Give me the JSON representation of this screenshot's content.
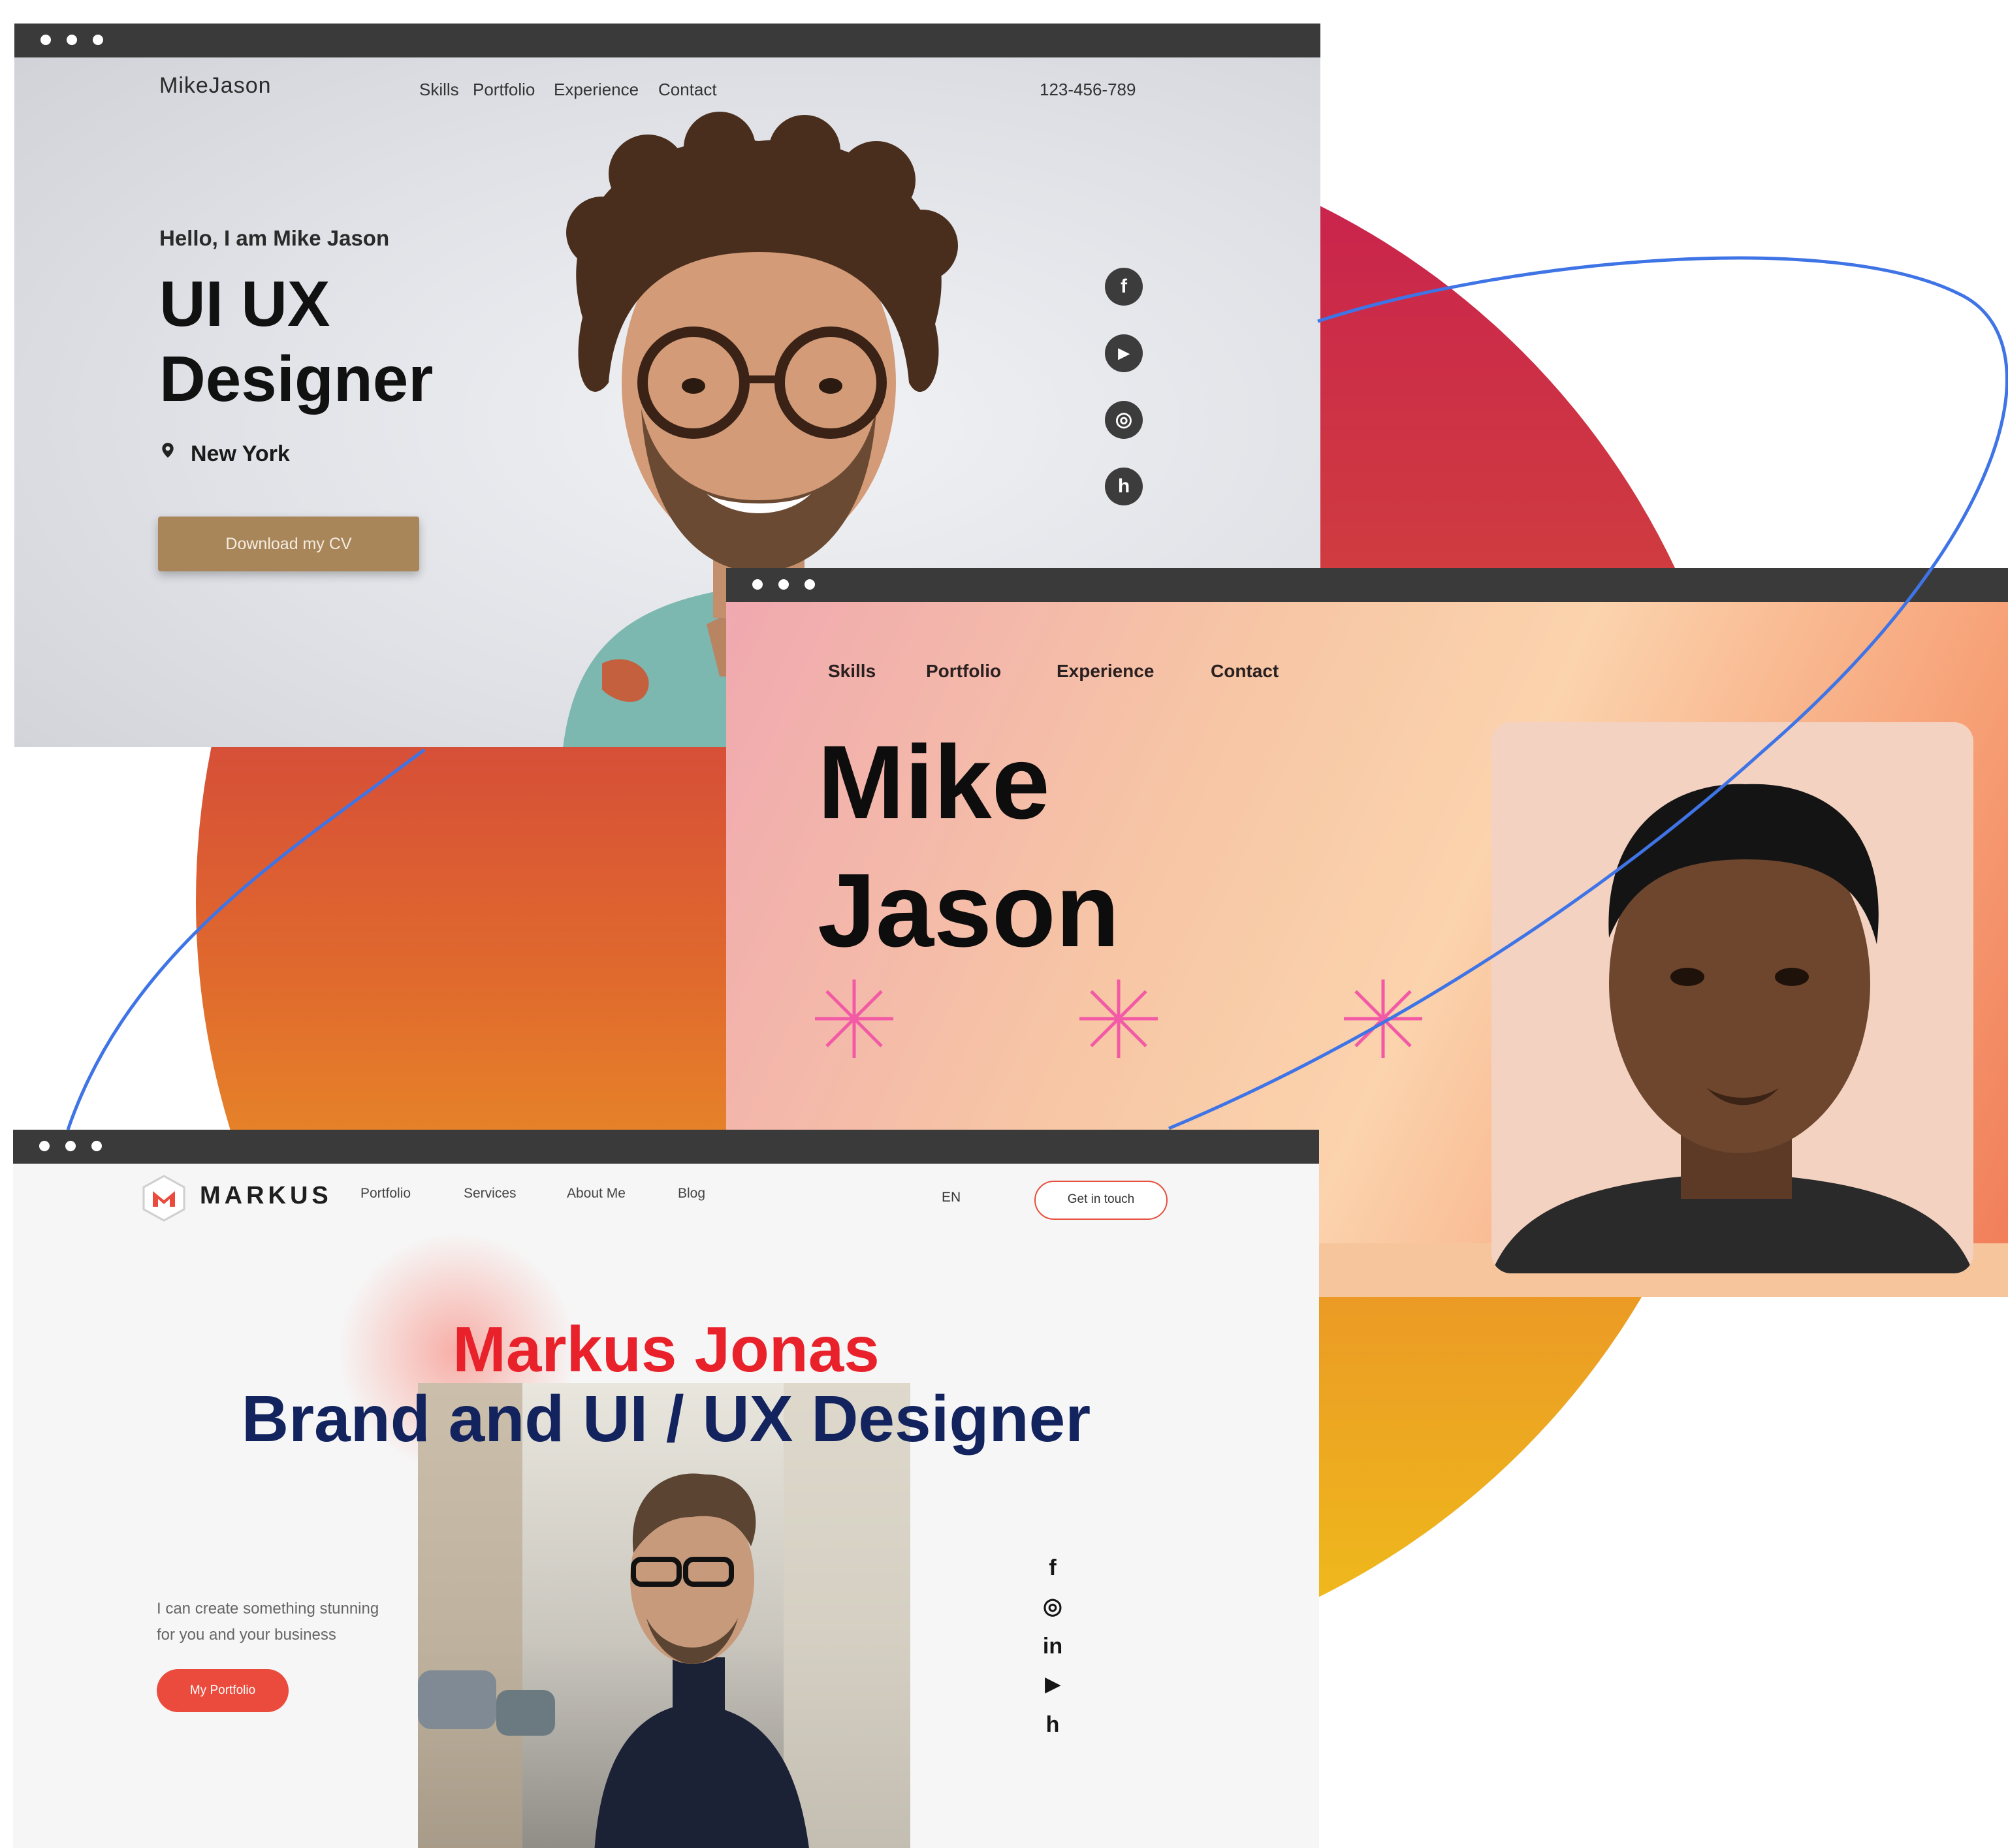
{
  "colors": {
    "accent_red": "#e8212b",
    "navy": "#12235e",
    "cv_button": "#a8865a",
    "portfolio_button": "#ea4b3c"
  },
  "window1": {
    "logo": "MikeJason",
    "nav": [
      "Skills",
      "Portfolio",
      "Experience",
      "Contact"
    ],
    "phone": "123-456-789",
    "greeting": "Hello, I am Mike Jason",
    "headline_line1": "UI UX",
    "headline_line2": "Designer",
    "location": "New York",
    "cv_button": "Download my CV",
    "social": [
      {
        "icon": "facebook-icon",
        "glyph": "f"
      },
      {
        "icon": "youtube-icon",
        "glyph": "▶"
      },
      {
        "icon": "instagram-icon",
        "glyph": "◎"
      },
      {
        "icon": "houzz-icon",
        "glyph": "h"
      }
    ]
  },
  "window2": {
    "nav": [
      "Skills",
      "Portfolio",
      "Experience",
      "Contact"
    ],
    "name_line1": "Mike",
    "name_line2": "Jason"
  },
  "window3": {
    "logo": "MARKUS",
    "nav": [
      "Portfolio",
      "Services",
      "About Me",
      "Blog"
    ],
    "language": "EN",
    "contact_button": "Get in touch",
    "name": "Markus Jonas",
    "title": "Brand and UI / UX Designer",
    "tagline_line1": "I can create something stunning",
    "tagline_line2": "for you and your business",
    "portfolio_button": "My Portfolio",
    "social": [
      {
        "icon": "facebook-icon",
        "glyph": "f"
      },
      {
        "icon": "instagram-icon",
        "glyph": "◎"
      },
      {
        "icon": "linkedin-icon",
        "glyph": "in"
      },
      {
        "icon": "youtube-icon",
        "glyph": "▶"
      },
      {
        "icon": "houzz-icon",
        "glyph": "h"
      }
    ]
  }
}
